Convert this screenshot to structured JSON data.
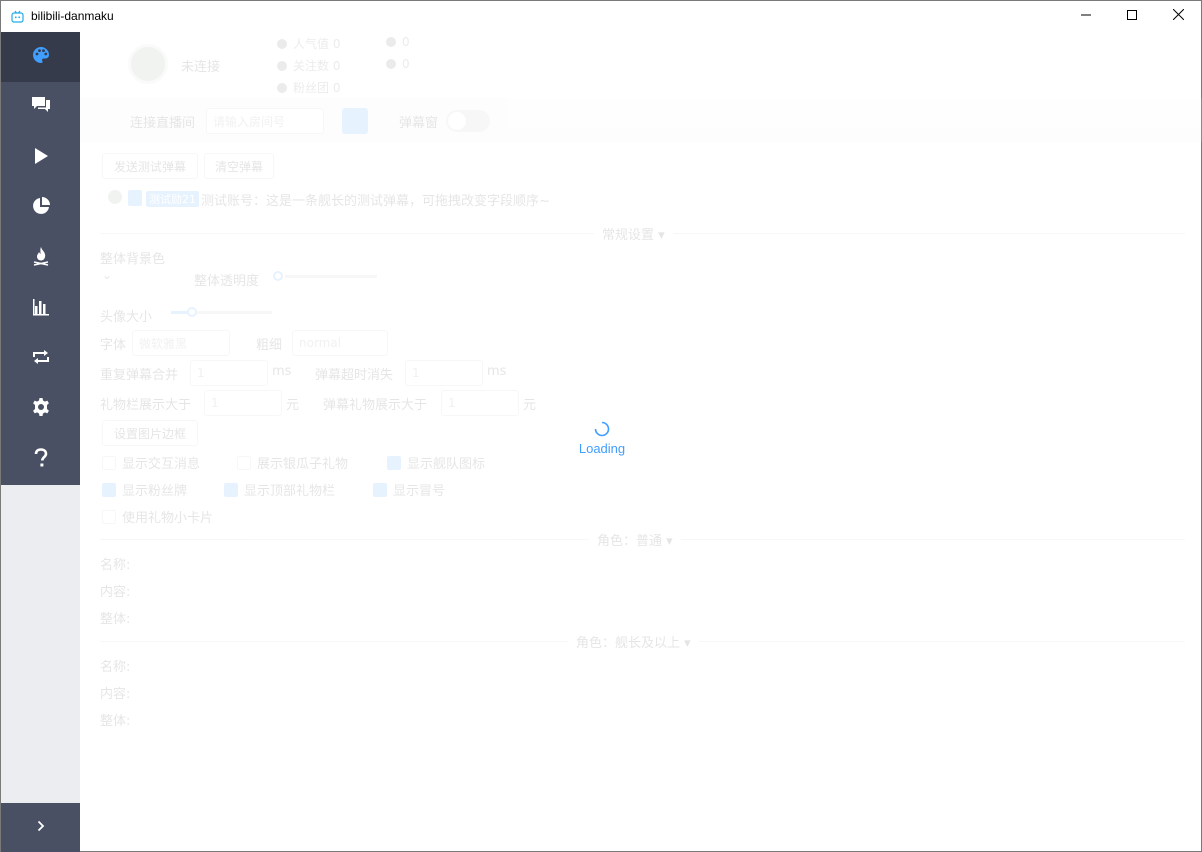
{
  "window": {
    "title": "bilibili-danmaku",
    "controls": {
      "minimize_icon": "minimize-icon",
      "maximize_icon": "maximize-icon",
      "close_icon": "close-icon"
    }
  },
  "sidebar": {
    "items": [
      {
        "name": "theme",
        "icon": "palette-icon",
        "active": true
      },
      {
        "name": "danmaku",
        "icon": "chat-icon",
        "active": false
      },
      {
        "name": "play",
        "icon": "play-icon",
        "active": false
      },
      {
        "name": "stats",
        "icon": "pie-chart-icon",
        "active": false
      },
      {
        "name": "hot",
        "icon": "fire-icon",
        "active": false
      },
      {
        "name": "chart",
        "icon": "bar-chart-icon",
        "active": false
      },
      {
        "name": "sync",
        "icon": "repeat-icon",
        "active": false
      },
      {
        "name": "settings",
        "icon": "gear-icon",
        "active": false
      },
      {
        "name": "help",
        "icon": "help-icon",
        "active": false
      }
    ],
    "collapse_icon": "chevron-right-icon"
  },
  "header": {
    "status": "未连接",
    "popularity": "人气值 0",
    "followers": "关注数 0",
    "fans_club": "粉丝团 0",
    "stat_a": "0",
    "stat_b": "0"
  },
  "connect": {
    "label": "连接直播间",
    "room_placeholder": "请输入房间号",
    "danmaku_window_label": "弹幕窗"
  },
  "actions": {
    "send_test": "发送测试弹幕",
    "clear": "清空弹幕"
  },
  "preview": {
    "tag": "测试勋21",
    "text": "测试账号：这是一条舰长的测试弹幕，可拖拽改变字段顺序~"
  },
  "sections": {
    "general": "常规设置",
    "role_normal": "角色：普通",
    "role_captain": "角色：舰长及以上"
  },
  "settings": {
    "bg_color": "整体背景色",
    "opacity": "整体透明度",
    "avatar_size": "头像大小",
    "font": "字体",
    "font_value": "微软雅黑",
    "weight": "粗细",
    "weight_value": "normal",
    "repeat_merge": "重复弹幕合并",
    "repeat_value": "1",
    "ms": "ms",
    "timeout": "弹幕超时消失",
    "timeout_value": "1",
    "gift_bar_min": "礼物栏展示大于",
    "gift_bar_value": "1",
    "yuan": "元",
    "gift_danmaku_min": "弹幕礼物展示大于",
    "gift_danmaku_value": "1",
    "border_button": "设置图片边框"
  },
  "checkboxes": [
    {
      "label": "显示交互消息",
      "checked": false
    },
    {
      "label": "展示银瓜子礼物",
      "checked": false
    },
    {
      "label": "显示舰队图标",
      "checked": true
    },
    {
      "label": "显示粉丝牌",
      "checked": true
    },
    {
      "label": "显示顶部礼物栏",
      "checked": true
    },
    {
      "label": "显示冒号",
      "checked": true
    },
    {
      "label": "使用礼物小卡片",
      "checked": false
    }
  ],
  "role_fields": {
    "name": "名称:",
    "content": "内容:",
    "whole": "整体:"
  },
  "loading": {
    "text": "Loading"
  },
  "colors": {
    "sidebar_bg": "#4a5064",
    "sidebar_active": "#363b4b",
    "accent": "#409eff"
  }
}
